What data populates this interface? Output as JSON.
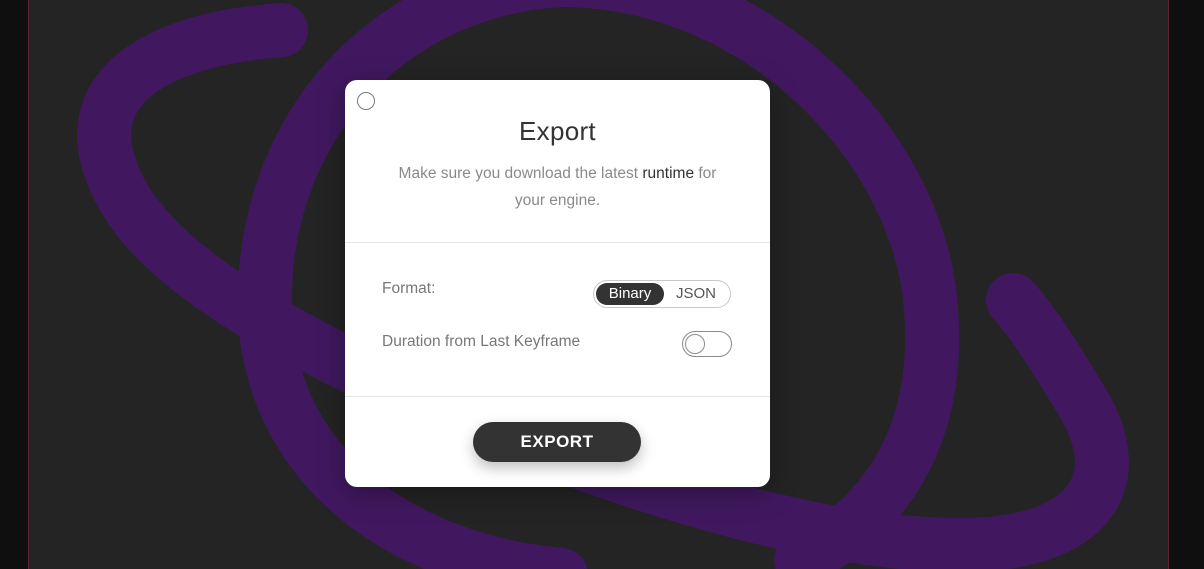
{
  "dialog": {
    "title": "Export",
    "subtitle_before": "Make sure you download the latest ",
    "subtitle_link": "runtime",
    "subtitle_after": " for your engine.",
    "format_label": "Format:",
    "format_options": [
      "Binary",
      "JSON"
    ],
    "format_selected": "Binary",
    "duration_label": "Duration from Last Keyframe",
    "duration_toggle_on": false,
    "export_label": "EXPORT"
  },
  "colors": {
    "canvas_background": "#2a2a2a",
    "artwork_stroke": "#4a1c6e",
    "dialog_background": "#ffffff",
    "primary_button": "#333333"
  }
}
